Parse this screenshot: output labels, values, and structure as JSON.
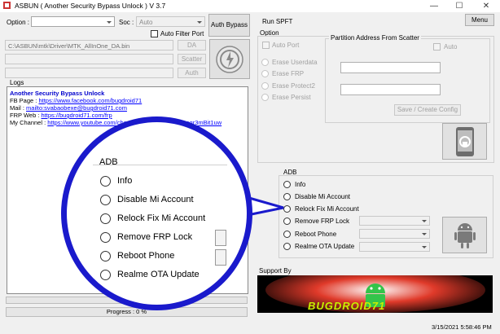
{
  "window": {
    "title": "ASBUN ( Another Security Bypass Unlock ) V 3.7",
    "min": "—",
    "max": "☐",
    "close": "✕"
  },
  "toolbar": {
    "option_label": "Option :",
    "soc_label": "Soc :",
    "soc_value": "Auto",
    "auth_bypass": "Auth Bypass",
    "auto_filter_port": "Auto Filter Port"
  },
  "files": {
    "da_path": "C:\\ASBUN\\mtk\\Driver\\MTK_AllInOne_DA.bin",
    "da_button": "DA",
    "scatter_button": "Scatter",
    "auth_button": "Auth"
  },
  "logs": {
    "title": "Logs",
    "heading": "Another Security Bypass Unlock",
    "lines": [
      {
        "label": "FB Page",
        "sep": " : ",
        "link": "https://www.facebook.com/bugdroid71"
      },
      {
        "label": "Mail",
        "sep": " : ",
        "link": "mailto:svabaobexe@bugdroid71.com"
      },
      {
        "label": "FRP Web",
        "sep": " : ",
        "link": "https://bugdroid71.com/frp"
      },
      {
        "label": "My Channel",
        "sep": " : ",
        "link": "https://www.youtube.com/channel/UCd...Edar8Eyamgr3mBit1uw"
      }
    ]
  },
  "progress": {
    "label": "Progress : 0 %",
    "percent": 0
  },
  "right": {
    "run_spft": "Run SPFT",
    "menu": "Menu",
    "option_title": "Option",
    "auto_port": "Auto Port",
    "options": [
      "Erase Userdata",
      "Erase FRP",
      "Erase Protect2",
      "Erase Persist"
    ],
    "partition_title": "Partition Address From Scatter",
    "auto": "Auto",
    "save_config": "Save / Create Config",
    "adb_title": "ADB",
    "adb_items": [
      "Info",
      "Disable Mi Account",
      "Relock Fix Mi Account",
      "Remove FRP Lock",
      "Reboot Phone",
      "Realme OTA Update"
    ],
    "support_title": "Support By",
    "support_banner": "BUGDROID71"
  },
  "zoom": {
    "title": "ADB",
    "items": [
      "Info",
      "Disable Mi Account",
      "Relock Fix Mi Account",
      "Remove FRP Lock",
      "Reboot Phone",
      "Realme OTA Update"
    ]
  },
  "status": {
    "datetime": "3/15/2021 5:58:46 PM"
  },
  "colors": {
    "accent_blue": "#1a1acc",
    "link": "#0000ff",
    "log_heading": "#0000cc"
  },
  "icons": {
    "auth": "power-bolt-icon",
    "unlock_phone": "phone-unlock-icon",
    "android": "android-robot-icon"
  }
}
